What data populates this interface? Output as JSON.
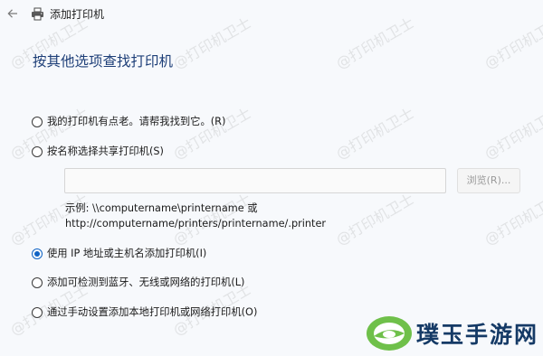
{
  "window": {
    "title": "添加打印机",
    "back_icon": "back-arrow-icon",
    "app_icon": "printer-icon"
  },
  "heading": "按其他选项查找打印机",
  "options": [
    {
      "label": "我的打印机有点老。请帮我找到它。(R)",
      "selected": false
    },
    {
      "label": "按名称选择共享打印机(S)",
      "selected": false
    },
    {
      "label": "使用 IP 地址或主机名添加打印机(I)",
      "selected": true
    },
    {
      "label": "添加可检测到蓝牙、无线或网络的打印机(L)",
      "selected": false
    },
    {
      "label": "通过手动设置添加本地打印机或网络打印机(O)",
      "selected": false
    }
  ],
  "share_input": {
    "value": "",
    "placeholder": ""
  },
  "browse_button": {
    "label": "浏览(R)...",
    "enabled": false
  },
  "example_lines": [
    "示例: \\\\computername\\printername 或",
    "http://computername/printers/printername/.printer"
  ],
  "watermark": {
    "text": "@打印机卫士"
  },
  "brand": {
    "text": "璞玉手游网",
    "logo": "brand-logo-icon"
  },
  "colors": {
    "heading": "#1e3f78",
    "accent": "#0f63c4",
    "background": "#f7f9fc"
  }
}
